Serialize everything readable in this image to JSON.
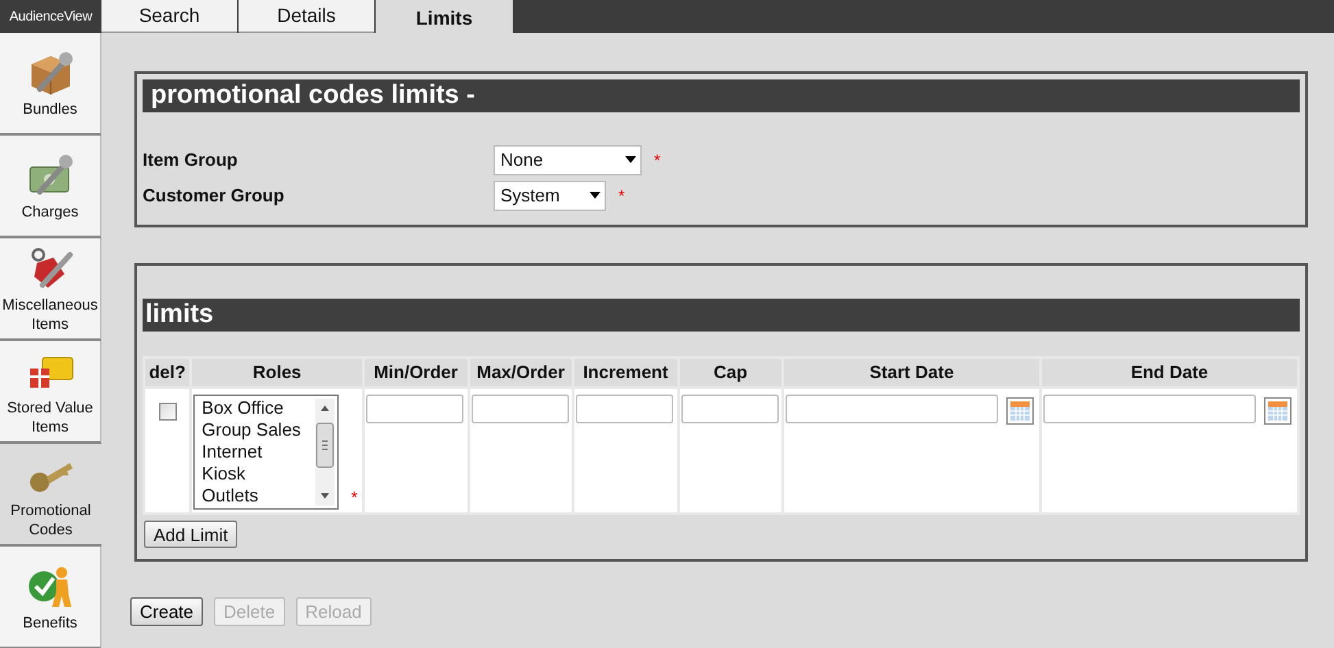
{
  "brand": "AudienceView",
  "tabs": [
    {
      "label": "Search",
      "selected": false
    },
    {
      "label": "Details",
      "selected": false
    },
    {
      "label": "Limits",
      "selected": true
    }
  ],
  "sidebar": {
    "items": [
      {
        "label": "Bundles",
        "kind": "box",
        "selected": false
      },
      {
        "label": "Charges",
        "kind": "cash",
        "selected": false
      },
      {
        "label": "Miscellaneous Items",
        "kind": "tag",
        "selected": false
      },
      {
        "label": "Stored Value Items",
        "kind": "card",
        "selected": false
      },
      {
        "label": "Promotional Codes",
        "kind": "key",
        "selected": true
      },
      {
        "label": "Benefits",
        "kind": "person",
        "selected": false
      }
    ]
  },
  "header_panel": {
    "title": "promotional codes limits -",
    "fields": [
      {
        "label": "Item Group",
        "value": "None",
        "required_mark": "*"
      },
      {
        "label": "Customer Group",
        "value": "System",
        "required_mark": "*"
      }
    ]
  },
  "limits_panel": {
    "title": "limits",
    "table": {
      "columns": [
        "del?",
        "Roles",
        "Min/Order",
        "Max/Order",
        "Increment",
        "Cap",
        "Start Date",
        "End Date"
      ],
      "rows": [
        {
          "del_checked": false,
          "roles": [
            "Box Office",
            "Group Sales",
            "Internet",
            "Kiosk",
            "Outlets"
          ],
          "roles_required_mark": "*"
        }
      ]
    },
    "add_button": "Add Limit"
  },
  "buttons": [
    {
      "label": "Create",
      "disabled": false
    },
    {
      "label": "Delete",
      "disabled": true
    },
    {
      "label": "Reload",
      "disabled": true
    }
  ]
}
